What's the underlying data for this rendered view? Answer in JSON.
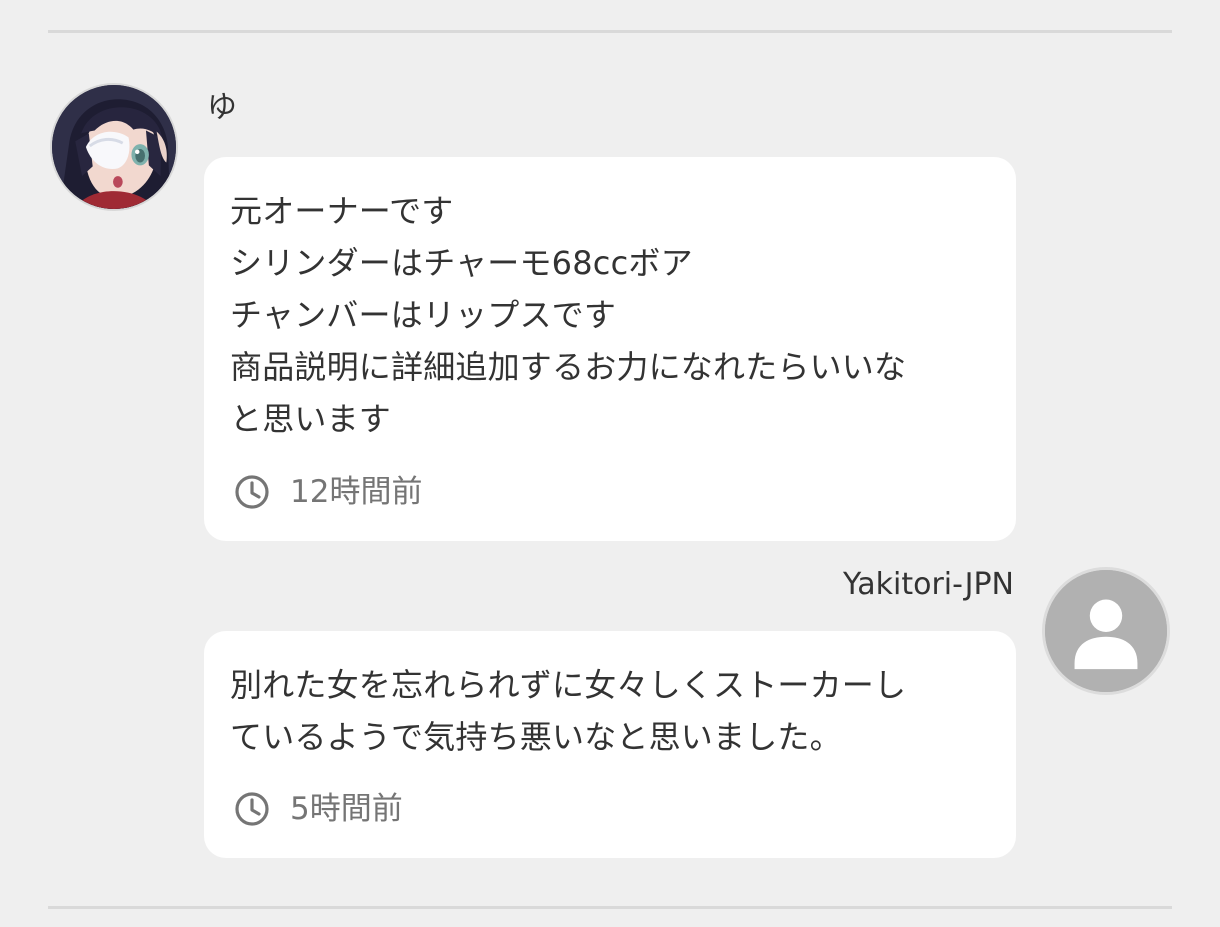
{
  "comments": [
    {
      "username": "ゆ",
      "text": "元オーナーです\nシリンダーはチャーモ68ccボア\nチャンバーはリップスです\n商品説明に詳細追加するお力になれたらいいな\nと思います",
      "timestamp": "12時間前",
      "avatar_icon": "anime-character-avatar"
    },
    {
      "username": "Yakitori-JPN",
      "text": "別れた女を忘れられずに女々しくストーカーし\nているようで気持ち悪いなと思いました。",
      "timestamp": "5時間前",
      "avatar_icon": "default-user-avatar"
    }
  ],
  "icons": {
    "time": "clock-icon"
  },
  "colors": {
    "background": "#efefef",
    "bubble": "#ffffff",
    "text": "#333333",
    "muted": "#757575",
    "divider": "#d9d9d9",
    "default_avatar": "#b1b1b1"
  }
}
